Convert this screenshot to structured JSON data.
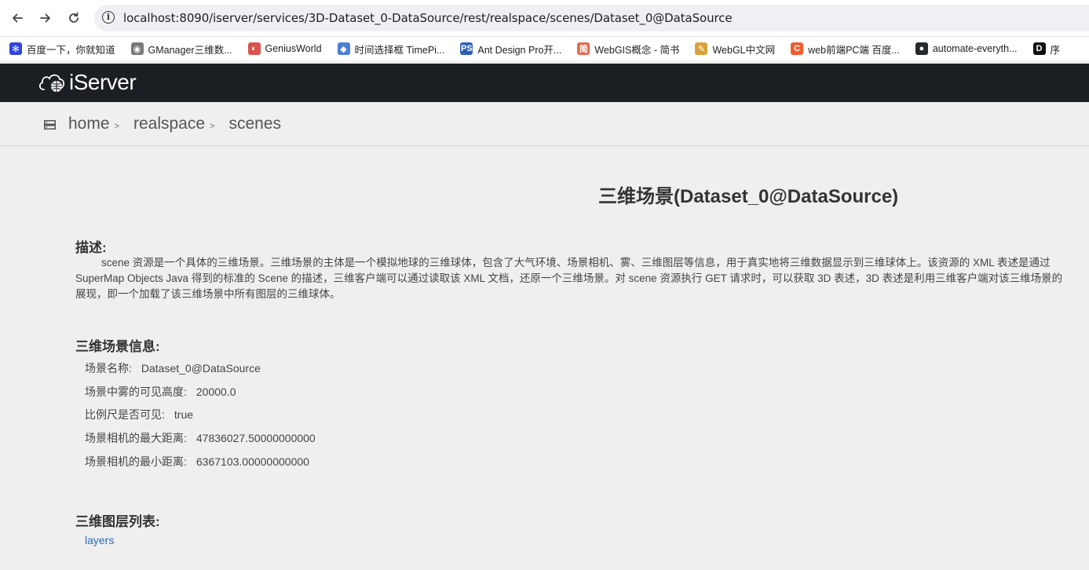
{
  "browser": {
    "url": "localhost:8090/iserver/services/3D-Dataset_0-DataSource/rest/realspace/scenes/Dataset_0@DataSource",
    "bookmarks": [
      {
        "label": "百度一下，你就知道",
        "icon": "baidu-paw-icon",
        "color": "#3245df"
      },
      {
        "label": "GManager三维数...",
        "icon": "globe-icon",
        "color": "#7a7a7a"
      },
      {
        "label": "GeniusWorld",
        "icon": "geniusworld-icon",
        "color": "#d9534f"
      },
      {
        "label": "时间选择框 TimePi...",
        "icon": "diamond-icon",
        "color": "#4a7fd6"
      },
      {
        "label": "Ant Design Pro开...",
        "icon": "ps-icon",
        "color": "#2d5fb7"
      },
      {
        "label": "WebGIS概念 - 简书",
        "icon": "jianshu-icon",
        "color": "#e8674a"
      },
      {
        "label": "WebGL中文网",
        "icon": "pencil-icon",
        "color": "#d8a23a"
      },
      {
        "label": "web前端PC端 百度...",
        "icon": "csdn-icon",
        "color": "#f25c2c"
      },
      {
        "label": "automate-everyth...",
        "icon": "github-icon",
        "color": "#24292e"
      },
      {
        "label": "序",
        "icon": "d-icon",
        "color": "#111111"
      }
    ]
  },
  "header": {
    "logo_prefix": "i",
    "logo_text": "Server"
  },
  "breadcrumb": {
    "items": [
      "home",
      "realspace",
      "scenes"
    ]
  },
  "main": {
    "title": "三维场景(Dataset_0@DataSource)",
    "desc_heading": "描述:",
    "description": "scene 资源是一个具体的三维场景。三维场景的主体是一个模拟地球的三维球体，包含了大气环境、场景相机、雾、三维图层等信息，用于真实地将三维数据显示到三维球体上。该资源的 XML 表述是通过 SuperMap Objects Java 得到的标准的 Scene 的描述，三维客户端可以通过读取该 XML 文档，还原一个三维场景。对 scene 资源执行 GET 请求时，可以获取 3D 表述，3D 表述是利用三维客户端对该三维场景的展现，即一个加载了该三维场景中所有图层的三维球体。",
    "info_heading": "三维场景信息:",
    "info": [
      {
        "label": "场景名称:",
        "value": "Dataset_0@DataSource"
      },
      {
        "label": "场景中雾的可见高度:",
        "value": "20000.0"
      },
      {
        "label": "比例尺是否可见:",
        "value": "true"
      },
      {
        "label": "场景相机的最大距离:",
        "value": "47836027.50000000000"
      },
      {
        "label": "场景相机的最小距离:",
        "value": "6367103.00000000000"
      }
    ],
    "layers_heading": "三维图层列表:",
    "layers_link": "layers"
  }
}
